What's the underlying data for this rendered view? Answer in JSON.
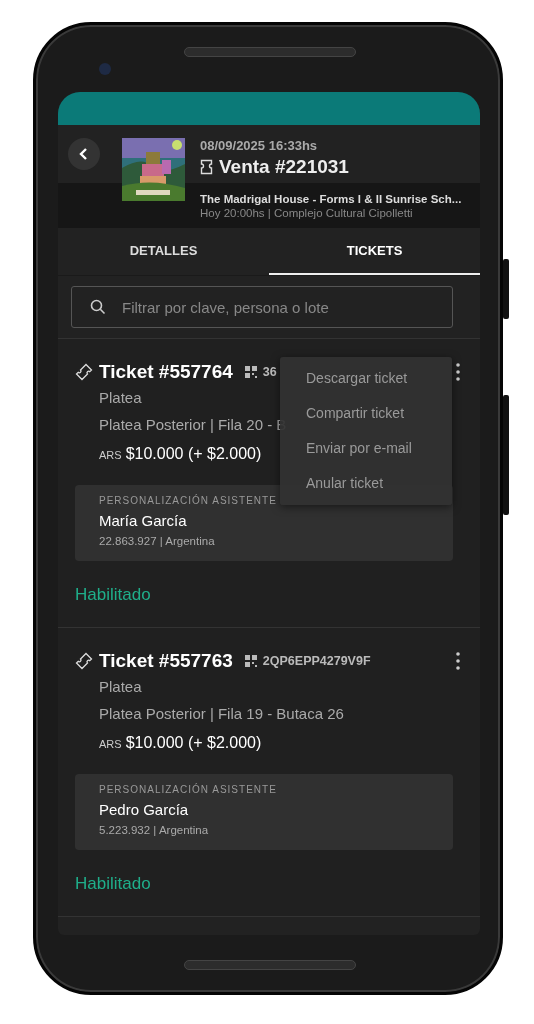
{
  "header": {
    "date": "08/09/2025 16:33hs",
    "title": "Venta #221031",
    "event_title": "The Madrigal House - Forms I & II Sunrise Sch...",
    "event_subtitle": "Hoy 20:00hs | Complejo Cultural Cipolletti"
  },
  "tabs": [
    {
      "label": "DETALLES",
      "selected": false
    },
    {
      "label": "TICKETS",
      "selected": true
    }
  ],
  "search": {
    "placeholder": "Filtrar por clave, persona o lote"
  },
  "tickets": [
    {
      "title": "Ticket #557764",
      "code": "36",
      "sector": "Platea",
      "seat": "Platea Posterior | Fila 20 - B",
      "currency": "ARS",
      "price": "$10.000 (+ $2.000)",
      "attendee_label": "PERSONALIZACIÓN ASISTENTE",
      "attendee_name": "María García",
      "attendee_info": "22.863.927 | Argentina",
      "status": "Habilitado",
      "menu": [
        "Descargar ticket",
        "Compartir ticket",
        "Enviar por e-mail",
        "Anular ticket"
      ]
    },
    {
      "title": "Ticket #557763",
      "code": "2QP6EPP4279V9F",
      "sector": "Platea",
      "seat": "Platea Posterior | Fila 19 - Butaca 26",
      "currency": "ARS",
      "price": "$10.000 (+ $2.000)",
      "attendee_label": "PERSONALIZACIÓN ASISTENTE",
      "attendee_name": "Pedro García",
      "attendee_info": "5.223.932 | Argentina",
      "status": "Habilitado"
    }
  ]
}
